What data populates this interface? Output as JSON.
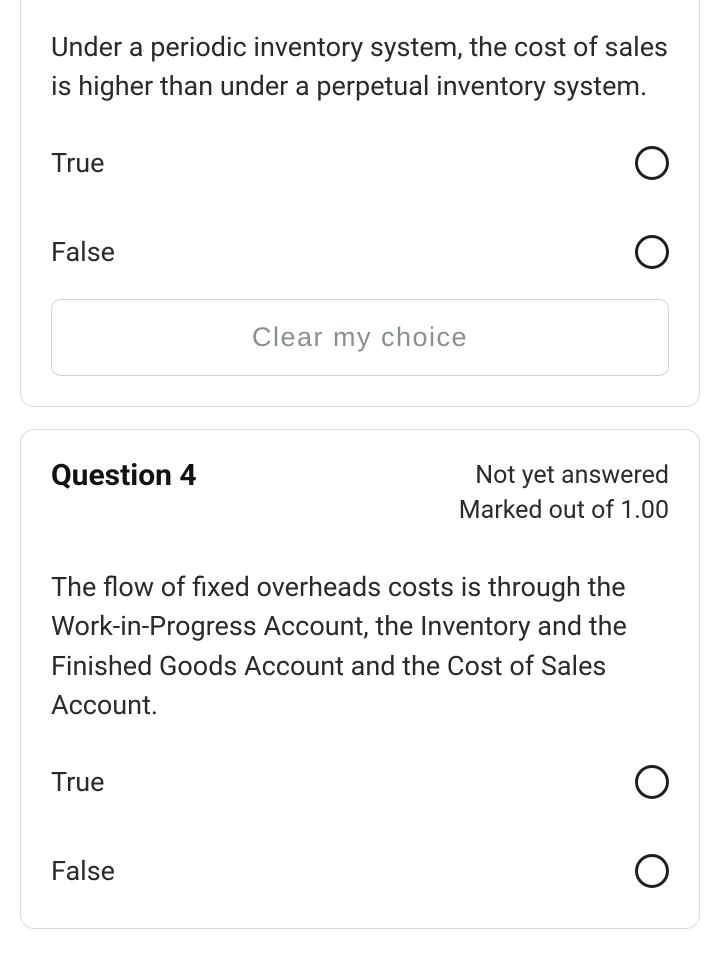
{
  "questions": [
    {
      "prompt": "Under a periodic inventory system, the cost of sales is higher than under a perpetual inventory system.",
      "options": [
        "True",
        "False"
      ],
      "clear_label": "Clear my choice"
    },
    {
      "number_label": "Question 4",
      "status": "Not yet answered",
      "marks": "Marked out of 1.00",
      "prompt": "The flow of fixed overheads costs is through the Work-in-Progress Account, the Inventory and the Finished Goods Account and the Cost of Sales Account.",
      "options": [
        "True",
        "False"
      ]
    }
  ]
}
